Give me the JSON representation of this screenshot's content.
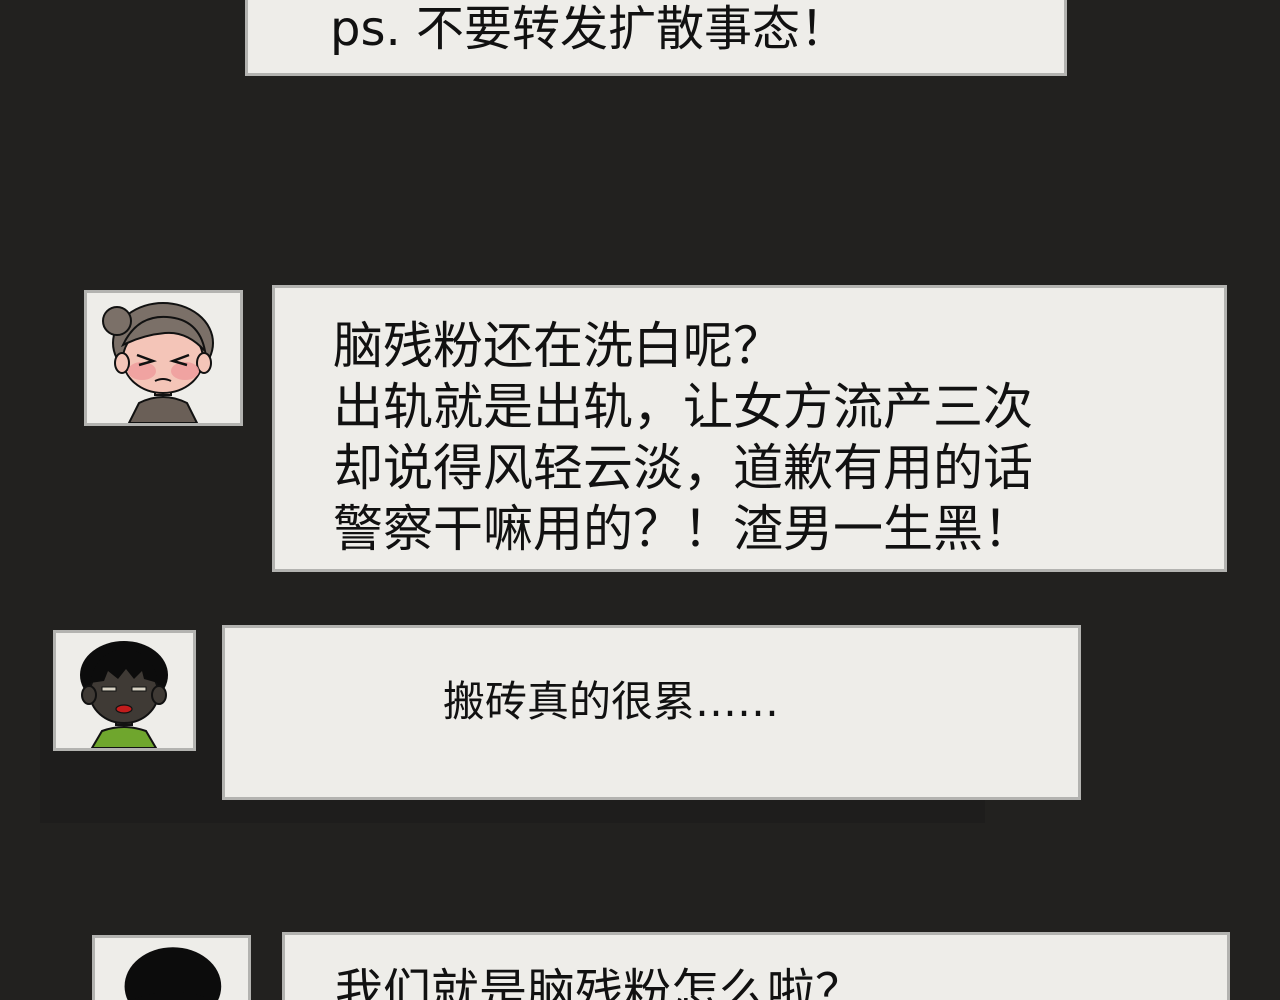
{
  "messages": [
    {
      "id": "m1",
      "lines": [
        "ps. 不要转发扩散事态！"
      ]
    },
    {
      "id": "m2",
      "lines": [
        "脑残粉还在洗白呢？",
        "出轨就是出轨，让女方流产三次",
        "却说得风轻云淡，道歉有用的话",
        "警察干嘛用的？！渣男一生黑！"
      ]
    },
    {
      "id": "m3",
      "lines": [
        "搬砖真的很累……"
      ]
    },
    {
      "id": "m4",
      "lines": [
        "我们就是脑残粉怎么啦？"
      ]
    }
  ],
  "avatars": [
    {
      "id": "a1",
      "icon": "angry-woman-bun-avatar"
    },
    {
      "id": "a2",
      "icon": "tired-dark-skin-woman-avatar"
    },
    {
      "id": "a3",
      "icon": "black-hair-person-avatar"
    }
  ]
}
